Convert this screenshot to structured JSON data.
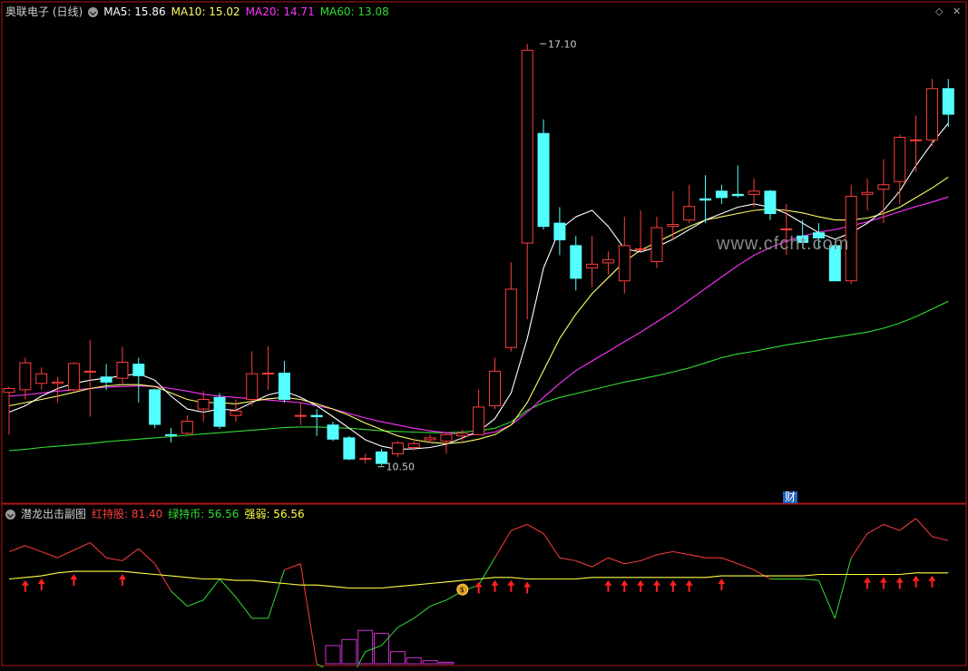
{
  "header": {
    "title": "奥联电子 (日线)",
    "ma5": "MA5: 15.86",
    "ma10": "MA10: 15.02",
    "ma20": "MA20: 14.71",
    "ma60": "MA60: 13.08"
  },
  "sub_header": {
    "title": "潜龙出击副图",
    "red": "红持股: 81.40",
    "green": "绿持币: 56.56",
    "strength": "强弱: 56.56"
  },
  "watermark": "www.cfcht.com",
  "cai_badge": "财",
  "colors": {
    "up": "#ff3d3d",
    "down": "#54ffff",
    "ma5": "#ffffff",
    "ma10": "#ffff66",
    "ma20": "#ff33ff",
    "ma60": "#33dd33",
    "panel_border": "#b01818",
    "strength": "#ffff44",
    "hist": "#cc33cc"
  },
  "chart_data": [
    {
      "type": "candlestick",
      "title": "奥联电子 (日线)",
      "price_range": [
        10.0,
        17.5
      ],
      "annotations": [
        {
          "label": "17.10",
          "index": 33,
          "value": 17.1
        },
        {
          "label": "10.50",
          "index": 23,
          "value": 10.5
        }
      ],
      "candles": [
        [
          11.66,
          11.72,
          11.0,
          11.75
        ],
        [
          11.7,
          12.12,
          11.55,
          12.2
        ],
        [
          11.8,
          11.95,
          11.7,
          12.05
        ],
        [
          11.8,
          11.82,
          11.5,
          11.9
        ],
        [
          11.7,
          12.11,
          11.68,
          12.13
        ],
        [
          11.98,
          11.99,
          11.28,
          12.48
        ],
        [
          11.9,
          11.82,
          11.7,
          12.1
        ],
        [
          11.88,
          12.13,
          11.8,
          12.37
        ],
        [
          12.1,
          11.92,
          11.5,
          12.2
        ],
        [
          11.7,
          11.16,
          11.1,
          11.72
        ],
        [
          11.0,
          10.99,
          10.88,
          11.1
        ],
        [
          11.02,
          11.21,
          11.0,
          11.3
        ],
        [
          11.4,
          11.55,
          11.2,
          11.68
        ],
        [
          11.58,
          11.13,
          11.09,
          11.65
        ],
        [
          11.3,
          11.37,
          11.2,
          11.55
        ],
        [
          11.55,
          11.95,
          11.45,
          12.3
        ],
        [
          11.95,
          11.96,
          11.7,
          12.38
        ],
        [
          11.96,
          11.55,
          11.5,
          12.15
        ],
        [
          11.3,
          11.3,
          11.15,
          11.5
        ],
        [
          11.3,
          11.28,
          10.98,
          11.4
        ],
        [
          11.15,
          10.93,
          10.9,
          11.2
        ],
        [
          10.95,
          10.62,
          10.6,
          10.98
        ],
        [
          10.62,
          10.63,
          10.55,
          10.7
        ],
        [
          10.73,
          10.55,
          10.52,
          10.78
        ],
        [
          10.7,
          10.87,
          10.65,
          10.9
        ],
        [
          10.8,
          10.86,
          10.75,
          10.9
        ],
        [
          10.92,
          10.95,
          10.87,
          11.0
        ],
        [
          10.9,
          11.0,
          10.7,
          11.03
        ],
        [
          10.98,
          11.02,
          10.9,
          11.08
        ],
        [
          11.0,
          11.43,
          11.0,
          11.7
        ],
        [
          11.45,
          11.99,
          11.4,
          12.2
        ],
        [
          12.36,
          13.27,
          12.3,
          13.69
        ],
        [
          13.99,
          17.0,
          12.8,
          17.1
        ],
        [
          15.7,
          14.25,
          14.2,
          15.92
        ],
        [
          14.3,
          14.04,
          13.8,
          14.55
        ],
        [
          13.95,
          13.44,
          13.25,
          14.1
        ],
        [
          13.6,
          13.66,
          13.3,
          14.1
        ],
        [
          13.68,
          13.73,
          13.5,
          13.86
        ],
        [
          13.4,
          13.95,
          13.2,
          14.4
        ],
        [
          13.9,
          13.9,
          13.85,
          14.5
        ],
        [
          13.7,
          14.23,
          13.6,
          14.4
        ],
        [
          14.25,
          14.28,
          14.05,
          14.8
        ],
        [
          14.35,
          14.56,
          14.3,
          14.9
        ],
        [
          14.68,
          14.66,
          14.3,
          15.05
        ],
        [
          14.8,
          14.7,
          14.6,
          14.9
        ],
        [
          14.75,
          14.73,
          14.7,
          15.2
        ],
        [
          14.75,
          14.8,
          14.55,
          15.0
        ],
        [
          14.8,
          14.45,
          14.35,
          14.82
        ],
        [
          14.2,
          14.21,
          13.8,
          14.6
        ],
        [
          14.1,
          14.0,
          14.0,
          14.35
        ],
        [
          14.15,
          14.07,
          13.9,
          14.3
        ],
        [
          13.95,
          13.4,
          13.4,
          13.97
        ],
        [
          13.4,
          14.72,
          13.35,
          14.9
        ],
        [
          14.75,
          14.78,
          14.5,
          15.0
        ],
        [
          14.83,
          14.9,
          14.3,
          15.3
        ],
        [
          14.95,
          15.64,
          14.6,
          15.68
        ],
        [
          15.6,
          15.6,
          15.1,
          15.98
        ],
        [
          15.6,
          16.4,
          15.5,
          16.55
        ],
        [
          16.4,
          16.0,
          15.8,
          16.55
        ]
      ],
      "ma5": [
        11.35,
        11.45,
        11.6,
        11.72,
        11.8,
        11.85,
        11.88,
        11.92,
        11.95,
        11.85,
        11.6,
        11.4,
        11.35,
        11.4,
        11.38,
        11.5,
        11.62,
        11.68,
        11.58,
        11.45,
        11.28,
        11.1,
        10.92,
        10.82,
        10.77,
        10.78,
        10.8,
        10.85,
        10.95,
        11.05,
        11.25,
        11.65,
        12.5,
        13.6,
        14.2,
        14.4,
        14.5,
        14.25,
        13.9,
        13.85,
        13.93,
        14.05,
        14.2,
        14.35,
        14.45,
        14.55,
        14.6,
        14.55,
        14.45,
        14.3,
        14.15,
        14.05,
        14.15,
        14.3,
        14.5,
        14.8,
        15.2,
        15.55,
        15.86
      ],
      "ma10": [
        11.45,
        11.5,
        11.55,
        11.6,
        11.66,
        11.72,
        11.76,
        11.78,
        11.78,
        11.75,
        11.65,
        11.55,
        11.5,
        11.5,
        11.48,
        11.52,
        11.56,
        11.58,
        11.55,
        11.48,
        11.4,
        11.3,
        11.18,
        11.08,
        10.98,
        10.92,
        10.88,
        10.86,
        10.88,
        10.93,
        11.0,
        11.15,
        11.5,
        12.0,
        12.5,
        12.88,
        13.2,
        13.45,
        13.7,
        13.88,
        14.0,
        14.13,
        14.25,
        14.35,
        14.4,
        14.45,
        14.5,
        14.52,
        14.5,
        14.46,
        14.4,
        14.35,
        14.35,
        14.38,
        14.45,
        14.55,
        14.7,
        14.85,
        15.02
      ],
      "ma20": [
        11.6,
        11.62,
        11.65,
        11.68,
        11.7,
        11.72,
        11.74,
        11.75,
        11.76,
        11.75,
        11.72,
        11.68,
        11.63,
        11.6,
        11.58,
        11.56,
        11.54,
        11.52,
        11.5,
        11.45,
        11.4,
        11.33,
        11.26,
        11.2,
        11.15,
        11.1,
        11.06,
        11.03,
        11.0,
        11.0,
        11.04,
        11.15,
        11.35,
        11.58,
        11.8,
        12.0,
        12.15,
        12.3,
        12.45,
        12.6,
        12.76,
        12.92,
        13.1,
        13.28,
        13.46,
        13.64,
        13.8,
        13.92,
        14.02,
        14.1,
        14.16,
        14.2,
        14.26,
        14.32,
        14.4,
        14.48,
        14.56,
        14.63,
        14.71
      ],
      "ma60": [
        10.75,
        10.77,
        10.8,
        10.82,
        10.84,
        10.86,
        10.89,
        10.91,
        10.93,
        10.95,
        10.97,
        10.99,
        11.01,
        11.03,
        11.05,
        11.07,
        11.09,
        11.11,
        11.12,
        11.12,
        11.11,
        11.1,
        11.08,
        11.06,
        11.05,
        11.04,
        11.03,
        11.03,
        11.04,
        11.06,
        11.1,
        11.2,
        11.38,
        11.5,
        11.58,
        11.64,
        11.7,
        11.76,
        11.82,
        11.87,
        11.92,
        11.98,
        12.04,
        12.12,
        12.2,
        12.26,
        12.3,
        12.35,
        12.4,
        12.44,
        12.48,
        12.52,
        12.56,
        12.6,
        12.66,
        12.74,
        12.84,
        12.96,
        13.08
      ]
    },
    {
      "type": "line",
      "title": "潜龙出击副图",
      "value_range": [
        0,
        100
      ],
      "series": [
        {
          "name": "红持股",
          "values": [
            74,
            78,
            74,
            70,
            75,
            80,
            70,
            68,
            76,
            66,
            58,
            48,
            52,
            57,
            48,
            50,
            52,
            62,
            66,
            55,
            50,
            45,
            38,
            40,
            45,
            48,
            50,
            52,
            53,
            54,
            70,
            88,
            92,
            86,
            70,
            68,
            64,
            70,
            66,
            68,
            72,
            74,
            72,
            70,
            70,
            66,
            62,
            58,
            58,
            56,
            55,
            55,
            70,
            86,
            92,
            88,
            96,
            84,
            81.4
          ]
        },
        {
          "name": "绿持币",
          "values": [
            56,
            56,
            58,
            60,
            62,
            62,
            54,
            42,
            32,
            40,
            48,
            38,
            42,
            56,
            44,
            30,
            30,
            16,
            12,
            0,
            -6,
            -12,
            8,
            12,
            24,
            30,
            38,
            42,
            48,
            52,
            54,
            55,
            56,
            56,
            56,
            56,
            56,
            56,
            56,
            56,
            56,
            56,
            56,
            56,
            56,
            56,
            56,
            56,
            56,
            56,
            55,
            30,
            50,
            56,
            56,
            56,
            56,
            56,
            56.56
          ]
        },
        {
          "name": "强弱",
          "values": [
            56,
            57,
            58,
            60,
            61,
            61,
            61,
            61,
            60,
            59,
            58,
            57,
            56,
            56,
            55,
            55,
            54,
            53,
            52,
            52,
            51,
            50,
            50,
            50,
            51,
            52,
            53,
            54,
            55,
            56,
            57,
            57,
            56,
            56,
            56,
            56,
            57,
            57,
            57,
            57,
            57,
            57,
            57,
            57,
            58,
            58,
            58,
            58,
            58,
            58,
            59,
            59,
            59,
            59,
            59,
            59,
            60,
            60,
            60
          ]
        }
      ],
      "bars": [
        {
          "index": 20,
          "value": 12
        },
        {
          "index": 21,
          "value": 16
        },
        {
          "index": 22,
          "value": 22
        },
        {
          "index": 23,
          "value": 20
        },
        {
          "index": 24,
          "value": 8
        },
        {
          "index": 25,
          "value": 4
        },
        {
          "index": 26,
          "value": 2
        },
        {
          "index": 27,
          "value": 1
        }
      ],
      "arrows_at": [
        1,
        2,
        4,
        7,
        29,
        30,
        31,
        32,
        37,
        38,
        39,
        40,
        41,
        42,
        44,
        53,
        54,
        55,
        56,
        57
      ],
      "money_icon_at": 28
    }
  ]
}
